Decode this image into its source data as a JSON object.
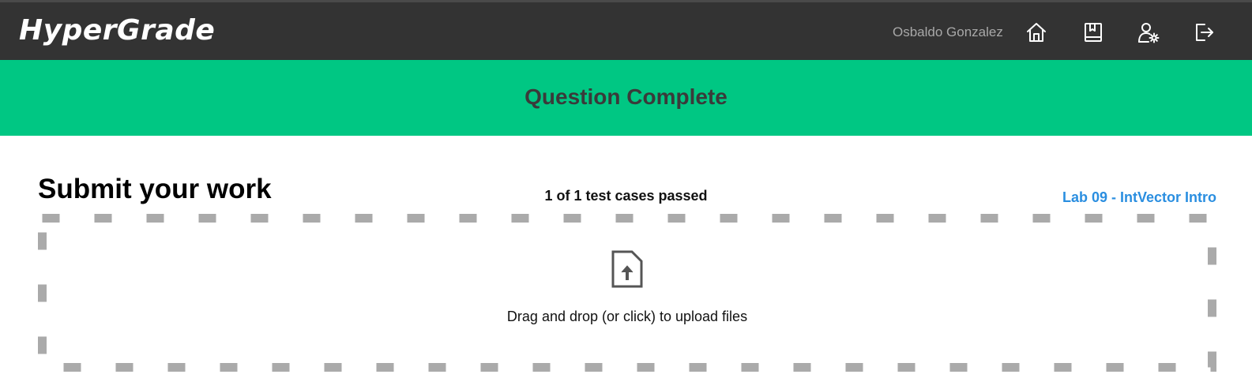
{
  "header": {
    "logo": "HyperGrade",
    "user_name": "Osbaldo Gonzalez",
    "icons": [
      "home-icon",
      "book-icon",
      "user-settings-icon",
      "logout-icon"
    ],
    "background": "#333333"
  },
  "banner": {
    "text": "Question Complete",
    "color": "#00c783"
  },
  "main": {
    "title": "Submit your work",
    "test_status": "1 of 1 test cases passed",
    "lab_link": "Lab 09 - IntVector Intro",
    "link_color": "#2a8ee0"
  },
  "dropzone": {
    "icon": "file-upload-icon",
    "text": "Drag and drop (or click) to upload files",
    "border_color": "#aaaaaa"
  }
}
